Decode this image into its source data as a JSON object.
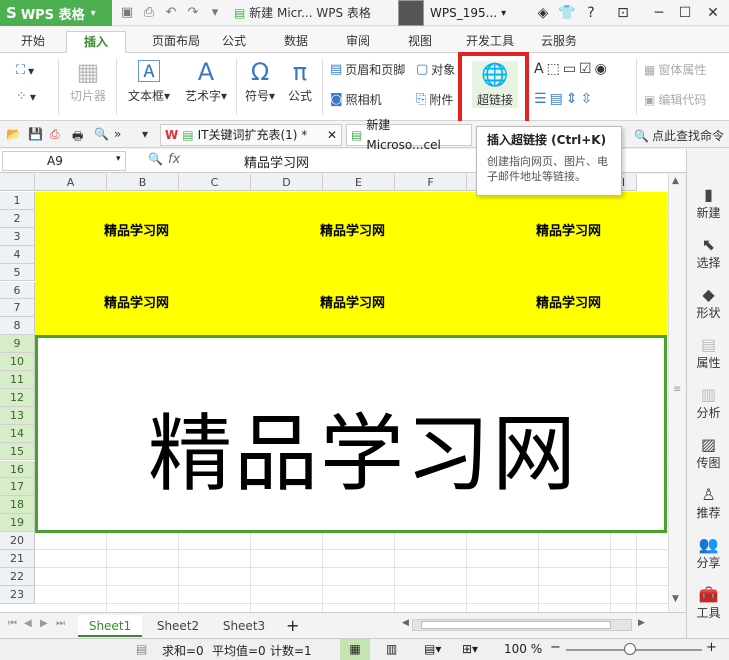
{
  "app": {
    "name": "WPS 表格",
    "logo": "S"
  },
  "window": {
    "title": "新建 Micr... WPS 表格",
    "user": "WPS_195..."
  },
  "tabs": [
    "开始",
    "插入",
    "页面布局",
    "公式",
    "数据",
    "审阅",
    "视图",
    "开发工具",
    "云服务"
  ],
  "active_tab": "插入",
  "ribbon": {
    "slicer": "切片器",
    "textbox": "文本框",
    "arttext": "艺术字",
    "symbol": "符号",
    "formula": "公式",
    "header_footer": "页眉和页脚",
    "object": "对象",
    "camera": "照相机",
    "attachment": "附件",
    "hyperlink": "超链接",
    "form_props": "窗体属性",
    "edit_code": "编辑代码"
  },
  "doc_tabs": [
    "IT关键词扩充表(1) *",
    "新建 Microso...cel"
  ],
  "find_commands": "点此查找命令",
  "tooltip": {
    "title": "插入超链接 (Ctrl+K)",
    "desc": "创建指向网页、图片、电子邮件地址等链接。"
  },
  "namebox": "A9",
  "fx": "fx",
  "formula_value": "精品学习网",
  "columns": [
    "A",
    "B",
    "C",
    "D",
    "E",
    "F",
    "G",
    "H",
    "I"
  ],
  "rows": [
    "1",
    "2",
    "3",
    "4",
    "5",
    "6",
    "7",
    "8",
    "9",
    "10",
    "11",
    "12",
    "13",
    "14",
    "15",
    "16",
    "17",
    "18",
    "19",
    "20",
    "21",
    "22",
    "23"
  ],
  "cell_text": "精品学习网",
  "big_text": "精品学习网",
  "right_panel": [
    "新建",
    "选择",
    "形状",
    "属性",
    "分析",
    "传图",
    "推荐",
    "分享",
    "工具"
  ],
  "sheets": [
    "Sheet1",
    "Sheet2",
    "Sheet3"
  ],
  "status": {
    "sum": "求和=0",
    "avg": "平均值=0",
    "count": "计数=1",
    "zoom": "100 %"
  },
  "colors": {
    "accent": "#4caf50",
    "highlight": "#ffff00",
    "red_box": "#e52222"
  }
}
